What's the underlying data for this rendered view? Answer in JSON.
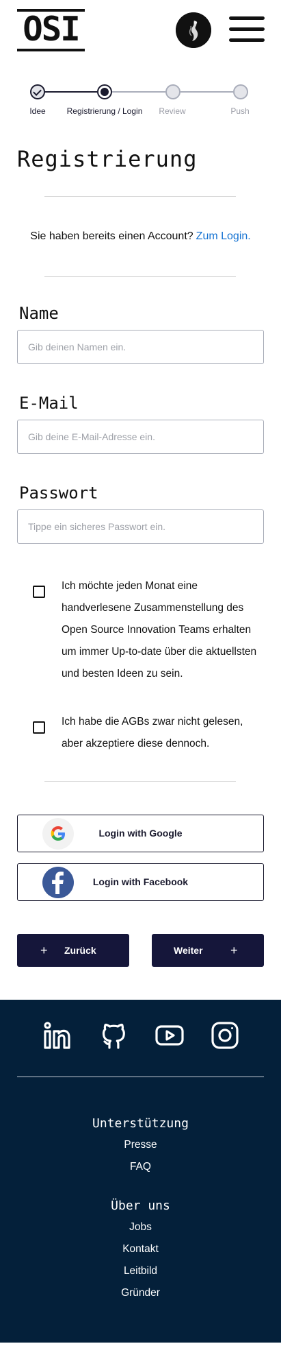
{
  "header": {
    "logo_text": "OSI",
    "avatar_label": "Profilbild",
    "menu_icon": "hamburger-menu-icon"
  },
  "stepper": {
    "steps": [
      {
        "label": "Idee",
        "state": "done"
      },
      {
        "label": "Registrierung / Login",
        "state": "current"
      },
      {
        "label": "Review",
        "state": "todo"
      },
      {
        "label": "Push",
        "state": "todo"
      }
    ],
    "colors": {
      "active": "#1a1a2e",
      "inactive": "#a9adba"
    }
  },
  "main": {
    "title": "Registrierung",
    "login_hint": {
      "text": "Sie haben bereits einen Account?",
      "link": "Zum Login."
    },
    "fields": {
      "name": {
        "label": "Name",
        "placeholder": "Gib deinen Namen ein.",
        "value": ""
      },
      "email": {
        "label": "E-Mail",
        "placeholder": "Gib deine E-Mail-Adresse ein.",
        "value": ""
      },
      "password": {
        "label": "Passwort",
        "placeholder": "Tippe ein sicheres Passwort ein.",
        "value": ""
      }
    },
    "checkboxes": {
      "newsletter": {
        "text": "Ich möchte jeden Monat eine handverlesene Zusammenstellung des Open Source Innovation Teams erhalten um immer Up-to-date über die aktuellsten und besten Ideen zu sein.",
        "checked": false
      },
      "agb": {
        "text": "Ich habe die AGBs zwar nicht gelesen, aber akzeptiere diese dennoch.",
        "checked": false
      }
    },
    "social": {
      "google": {
        "label": "Login with Google",
        "icon": "google-icon"
      },
      "facebook": {
        "label": "Login with Facebook",
        "icon": "facebook-icon"
      }
    },
    "nav": {
      "back": {
        "label": "Zurück",
        "icon": "plus-icon"
      },
      "next": {
        "label": "Weiter",
        "icon": "plus-icon"
      }
    }
  },
  "footer": {
    "social_icons": [
      "linkedin-icon",
      "github-icon",
      "youtube-icon",
      "instagram-icon"
    ],
    "sections": [
      {
        "heading": "Unterstützung",
        "links": [
          "Presse",
          "FAQ"
        ]
      },
      {
        "heading": "Über uns",
        "links": [
          "Jobs",
          "Kontakt",
          "Leitbild",
          "Gründer"
        ]
      }
    ],
    "background": "#04203a"
  },
  "colors": {
    "primary": "#15163a",
    "link": "#1472d2",
    "footer": "#04203a",
    "facebook": "#3b5998"
  }
}
